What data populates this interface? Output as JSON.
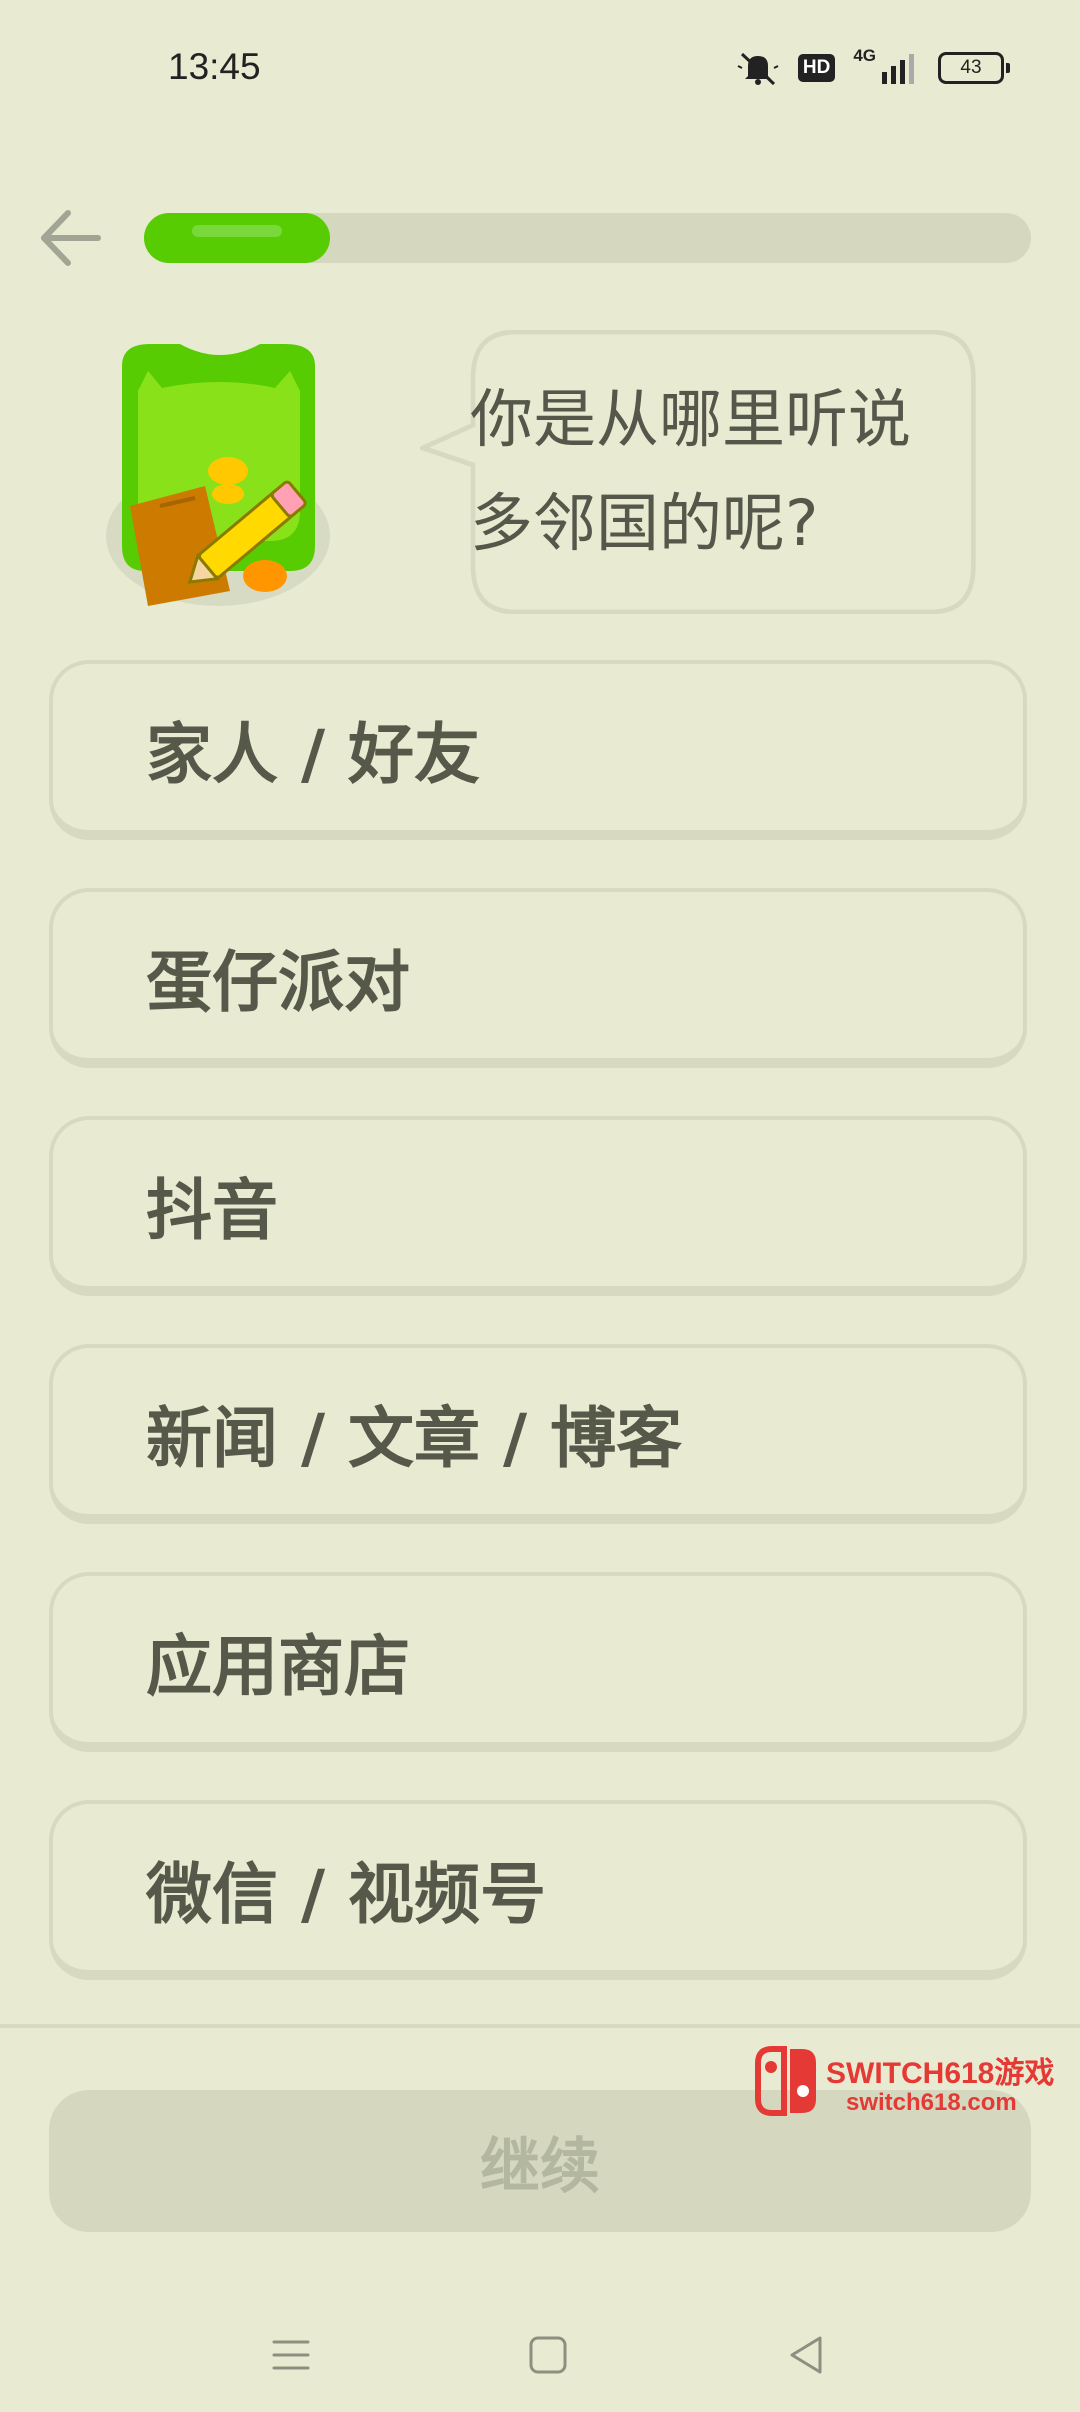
{
  "status_bar": {
    "time": "13:45",
    "icons": [
      "mute-icon",
      "hd-icon",
      "signal-4g-icon",
      "battery-icon"
    ],
    "hd_label": "HD",
    "network_label": "4G",
    "battery_level": "43"
  },
  "header": {
    "back_icon": "arrow-left-icon",
    "progress_fraction": 0.21
  },
  "prompt": {
    "text_line1": "你是从哪里听说",
    "text_line2": "多邻国的呢?"
  },
  "options": [
    {
      "label": "家人 / 好友"
    },
    {
      "label": "蛋仔派对"
    },
    {
      "label": "抖音"
    },
    {
      "label": "新闻 / 文章 / 博客"
    },
    {
      "label": "应用商店"
    },
    {
      "label": "微信 / 视频号"
    }
  ],
  "footer": {
    "continue_label": "继续"
  },
  "watermark": {
    "title": "SWITCH618游戏",
    "url": "switch618.com"
  },
  "nav_bar": {
    "icons": [
      "menu-icon",
      "home-icon",
      "back-triangle-icon"
    ]
  },
  "colors": {
    "background": "#e8ebd1",
    "accent_green": "#58cc02",
    "border": "#d7dac1",
    "text": "#56584a",
    "disabled_button": "#d5d8bf",
    "watermark_red": "#e53935"
  }
}
